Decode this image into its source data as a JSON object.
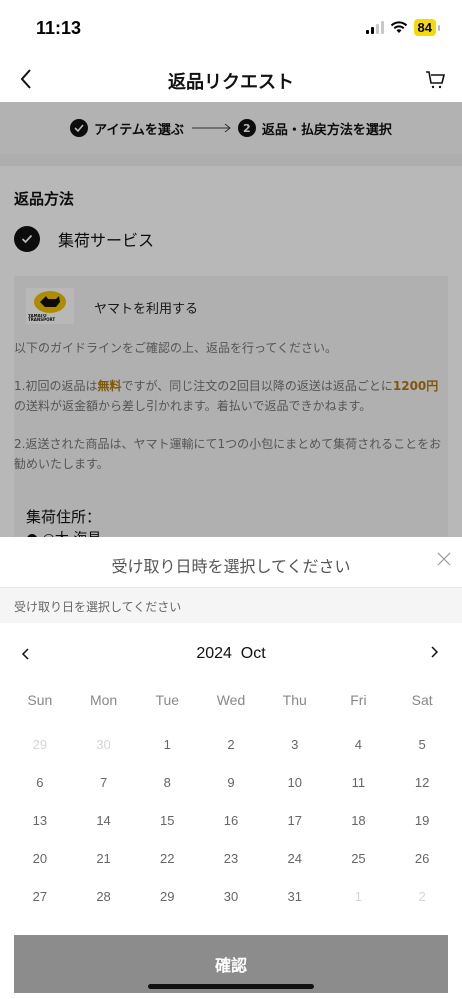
{
  "status_bar": {
    "time": "11:13",
    "battery": "84"
  },
  "nav": {
    "title": "返品リクエスト",
    "back_icon": "chevron-left-icon",
    "cart_icon": "cart-icon"
  },
  "steps": {
    "step1": "アイテムを選ぶ",
    "step2_number": "2",
    "step2": "返品・払戻方法を選択"
  },
  "return_method": {
    "section_title": "返品方法",
    "option": "集荷サービス",
    "carrier_label": "ヤマトを利用する",
    "logo_text": "YAMATO TRANSPORT",
    "guide_intro": "以下のガイドラインをご確認の上、返品を行ってください。",
    "guide_1_a": "1.初回の返品は",
    "guide_1_free": "無料",
    "guide_1_b": "ですが、同じ注文の2回目以降の返送は返品ごとに",
    "guide_1_fee": "1200円",
    "guide_1_c": "の送料が返金額から差し引かれます。着払いで返品できかねます。",
    "guide_2": "2.返送された商品は、ヤマト運輸にて1つの小包にまとめて集荷されることをお勧めいたします。",
    "address_title": "集荷住所：",
    "address_line": "● ○大 海見"
  },
  "sheet": {
    "title": "受け取り日時を選択してください",
    "date_hint": "受け取り日を選択してください",
    "calendar_title": "2024  Oct",
    "weekdays": [
      "Sun",
      "Mon",
      "Tue",
      "Wed",
      "Thu",
      "Fri",
      "Sat"
    ],
    "days": [
      "29",
      "30",
      "1",
      "2",
      "3",
      "4",
      "5",
      "6",
      "7",
      "8",
      "9",
      "10",
      "11",
      "12",
      "13",
      "14",
      "15",
      "16",
      "17",
      "18",
      "19",
      "20",
      "21",
      "22",
      "23",
      "24",
      "25",
      "26",
      "27",
      "28",
      "29",
      "30",
      "31",
      "1",
      "2"
    ],
    "confirm_label": "確認"
  },
  "colors": {
    "highlight": "#b07a12",
    "confirm_button": "#8c8c8c",
    "battery": "#f5d90a"
  }
}
